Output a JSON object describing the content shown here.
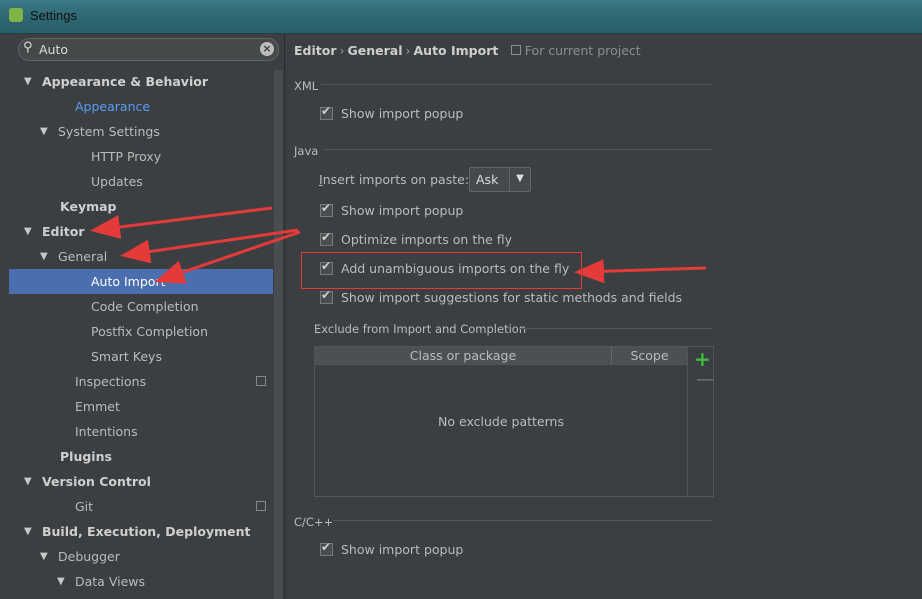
{
  "window": {
    "title": "Settings"
  },
  "search": {
    "query": "Auto"
  },
  "tree": [
    {
      "label": "Appearance & Behavior",
      "arrow": "▼",
      "bold": true
    },
    {
      "label": "Appearance",
      "arrow": "",
      "highlight": true
    },
    {
      "label": "System Settings",
      "arrow": "▼"
    },
    {
      "label": "HTTP Proxy",
      "arrow": ""
    },
    {
      "label": "Updates",
      "arrow": ""
    },
    {
      "label": "Keymap",
      "arrow": "",
      "bold": true
    },
    {
      "label": "Editor",
      "arrow": "▼",
      "bold": true
    },
    {
      "label": "General",
      "arrow": "▼"
    },
    {
      "label": "Auto Import",
      "arrow": "",
      "selected": true
    },
    {
      "label": "Code Completion",
      "arrow": ""
    },
    {
      "label": "Postfix Completion",
      "arrow": ""
    },
    {
      "label": "Smart Keys",
      "arrow": ""
    },
    {
      "label": "Inspections",
      "arrow": "",
      "copy": true
    },
    {
      "label": "Emmet",
      "arrow": ""
    },
    {
      "label": "Intentions",
      "arrow": ""
    },
    {
      "label": "Plugins",
      "arrow": "",
      "bold": true
    },
    {
      "label": "Version Control",
      "arrow": "▼",
      "bold": true
    },
    {
      "label": "Git",
      "arrow": "",
      "copy": true
    },
    {
      "label": "Build, Execution, Deployment",
      "arrow": "▼",
      "bold": true
    },
    {
      "label": "Debugger",
      "arrow": "▼"
    },
    {
      "label": "Data Views",
      "arrow": "▼"
    }
  ],
  "breadcrumb": {
    "part1": "Editor",
    "part2": "General",
    "part3": "Auto Import",
    "scope": "For current project",
    "sep": "›"
  },
  "xml": {
    "title": "XML",
    "show_popup": "Show import popup"
  },
  "java": {
    "title": "Java",
    "insert_label_ul": "I",
    "insert_label_rest": "nsert imports on paste:",
    "insert_value": "Ask",
    "show_popup": "Show import popup",
    "optimize": "Optimize imports on the fly",
    "unambiguous": "Add unambiguous imports on the fly",
    "static": "Show import suggestions for static methods and fields"
  },
  "exclude": {
    "title": "Exclude from Import and Completion",
    "col_class": "Class or package",
    "col_scope": "Scope",
    "empty": "No exclude patterns",
    "add": "+",
    "remove": "—"
  },
  "cpp": {
    "title": "C/C++",
    "show_popup": "Show import popup"
  },
  "colors": {
    "selection": "#4b6eaf",
    "arrow": "#e53a3a",
    "link": "#589df6"
  }
}
